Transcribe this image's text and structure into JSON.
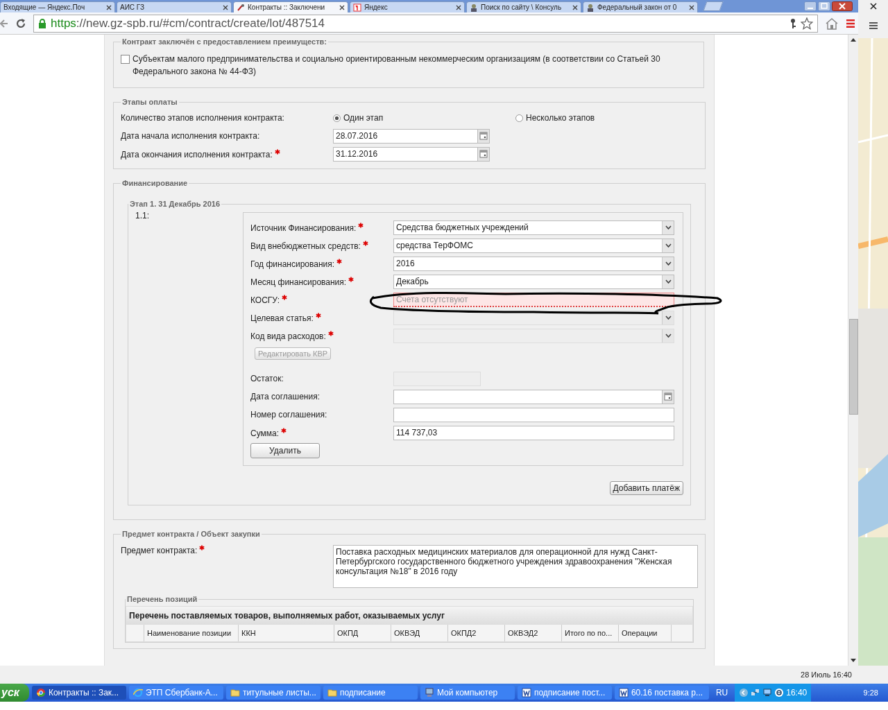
{
  "browser": {
    "tabs": [
      {
        "label": "Входящие — Яндекс.Поч",
        "kind": "plain",
        "selected": false
      },
      {
        "label": "АИС ГЗ",
        "kind": "plain",
        "selected": false
      },
      {
        "label": "Контракты :: Заключени",
        "kind": "tool",
        "selected": true
      },
      {
        "label": "Яндекс",
        "kind": "letter",
        "selected": false
      },
      {
        "label": "Поиск по сайту \\ Консуль",
        "kind": "person",
        "selected": false
      },
      {
        "label": "Федеральный закон от 0",
        "kind": "person",
        "selected": false
      }
    ],
    "url_scheme": "https",
    "url_rest": "://new.gz-spb.ru/#cm/contract/create/lot/487514"
  },
  "advantages": {
    "legend": "Контракт заключён с предоставлением преимуществ:",
    "checkbox": {
      "label": "Субъектам малого предпринимательства и социально ориентированным некоммерческим организациям (в соответствии со Статьей 30 Федерального закона № 44-ФЗ)",
      "checked": false
    }
  },
  "payment_stages": {
    "legend": "Этапы оплаты",
    "count_label": "Количество этапов исполнения контракта:",
    "options": [
      {
        "label": "Один этап",
        "selected": true
      },
      {
        "label": "Несколько этапов",
        "selected": false
      }
    ],
    "fields": [
      {
        "label": "Дата начала исполнения контракта:",
        "required": false,
        "value": "28.07.2016"
      },
      {
        "label": "Дата окончания исполнения контракта:",
        "required": true,
        "value": "31.12.2016"
      }
    ]
  },
  "financing": {
    "legend": "Финансирование",
    "stage_legend": "Этап 1. 31 Декабрь 2016",
    "number": "1.1:",
    "fields_top": [
      {
        "kind": "select",
        "label": "Источник Финансирования:",
        "required": true,
        "value": "Средства бюджетных учреждений",
        "disabled": false
      },
      {
        "kind": "select",
        "label": "Вид внебюджетных средств:",
        "required": true,
        "value": "средства ТерФОМС",
        "disabled": false
      },
      {
        "kind": "select",
        "label": "Год финансирования:",
        "required": true,
        "value": "2016",
        "disabled": false
      },
      {
        "kind": "select",
        "label": "Месяц финансирования:",
        "required": true,
        "value": "Декабрь",
        "disabled": false
      },
      {
        "kind": "error",
        "label": "КОСГУ:",
        "required": true,
        "placeholder": "Счета отсутствуют"
      },
      {
        "kind": "select",
        "label": "Целевая статья:",
        "required": true,
        "disabled": true
      },
      {
        "kind": "select",
        "label": "Код вида расходов:",
        "required": true,
        "disabled": true
      }
    ],
    "edit_button": {
      "label": "Редактировать КВР",
      "disabled": true
    },
    "fields_bottom": [
      {
        "kind": "short",
        "label": "Остаток:",
        "required": false,
        "disabled": true
      },
      {
        "kind": "date",
        "label": "Дата соглашения:",
        "required": false
      },
      {
        "kind": "text",
        "label": "Номер соглашения:",
        "required": false
      },
      {
        "kind": "text",
        "label": "Сумма:",
        "required": true,
        "value": "114 737,03"
      }
    ],
    "delete_button": "Удалить",
    "add_button": "Добавить платёж"
  },
  "subject": {
    "legend": "Предмет контракта / Объект закупки",
    "label": "Предмет контракта:",
    "required": true,
    "value": "Поставка расходных медицинских материалов для операционной для нужд Санкт-Петербургского государственного бюджетного учреждения здравоохранения \"Женская консультация №18\" в 2016 году",
    "positions_legend": "Перечень позиций",
    "table_title": "Перечень поставляемых товаров, выполняемых работ, оказываемых услуг",
    "columns": [
      "Наименование позиции",
      "ККН",
      "ОКПД",
      "ОКВЭД",
      "ОКПД2",
      "ОКВЭД2",
      "Итого по по...",
      "Операции"
    ]
  },
  "status_date": "28 Июль 16:40",
  "taskbar": {
    "start": "уск",
    "items": [
      {
        "kind": "browser",
        "label": "Контракты :: Зак...",
        "selected": true
      },
      {
        "kind": "explorer",
        "label": "ЭТП Сбербанк-А...",
        "selected": false
      },
      {
        "kind": "folder",
        "label": "титульные листы...",
        "selected": false
      },
      {
        "kind": "folder",
        "label": "подписание",
        "selected": false
      },
      {
        "kind": "computer",
        "label": "Мой компьютер",
        "selected": false
      },
      {
        "kind": "document",
        "label": "подписание пост...",
        "selected": false
      },
      {
        "kind": "document",
        "label": "60.16  поставка р...",
        "selected": false
      }
    ],
    "lang": "RU",
    "clock": "16:40",
    "corner_time": "9:28"
  }
}
